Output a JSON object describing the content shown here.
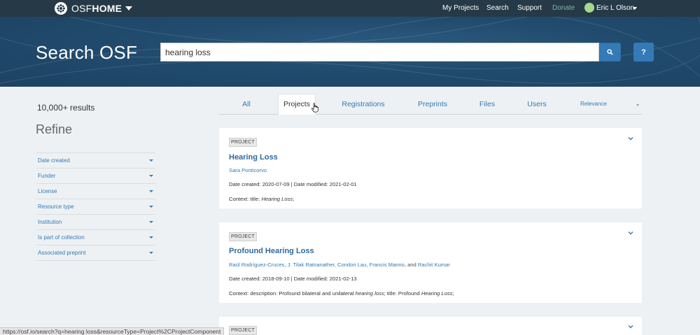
{
  "navbar": {
    "brand_light": "OSF",
    "brand_bold": "HOME",
    "links": {
      "my_projects": "My Projects",
      "search": "Search",
      "support": "Support",
      "donate": "Donate"
    },
    "user_name": "Eric L Olson"
  },
  "hero": {
    "title": "Search OSF",
    "search_value": "hearing loss",
    "help_label": "?"
  },
  "sidebar": {
    "results_count": "10,000+ results",
    "refine_title": "Refine",
    "filters": [
      {
        "label": "Date created"
      },
      {
        "label": "Funder"
      },
      {
        "label": "License"
      },
      {
        "label": "Resource type"
      },
      {
        "label": "Institution"
      },
      {
        "label": "Is part of collection"
      },
      {
        "label": "Associated preprint"
      }
    ]
  },
  "tabs": {
    "all": "All",
    "projects": "Projects",
    "registrations": "Registrations",
    "preprints": "Preprints",
    "files": "Files",
    "users": "Users",
    "active": "projects"
  },
  "sort": {
    "selected": "Relevance"
  },
  "results": [
    {
      "badge": "PROJECT",
      "title": "Hearing Loss",
      "authors": [
        "Sara Ponticorvo"
      ],
      "dates": "Date created: 2020-07-09 | Date modified: 2021-02-01",
      "context_prefix": "Context: title: ",
      "context_italic": "Hearing Loss",
      "context_suffix": ";"
    },
    {
      "badge": "PROJECT",
      "title": "Profound Hearing Loss",
      "authors": [
        "Raúl Rodríguez-Cruces",
        "J. Tilak Ratnanather",
        "Condon Lau",
        "Francis Manno",
        "Rachit Kumar"
      ],
      "author_sep": ",",
      "author_last_sep": ", and",
      "dates": "Date created: 2018-09-10 | Date modified: 2021-02-13",
      "context_prefix": "Context: description: Profound bilateral and unilateral ",
      "context_italic": "hearing loss",
      "context_mid": "; title: Profound ",
      "context_italic2": "Hearing Loss",
      "context_suffix": ";"
    },
    {
      "badge": "PROJECT"
    }
  ],
  "status_bar": {
    "url": "https://osf.io/search?q=hearing loss&resourceType=Project%2CProjectComponent"
  },
  "colors": {
    "navbar_bg": "#263947",
    "hero_bg": "#214b6d",
    "link_blue": "#337ab7",
    "page_bg": "#eef1f3"
  }
}
